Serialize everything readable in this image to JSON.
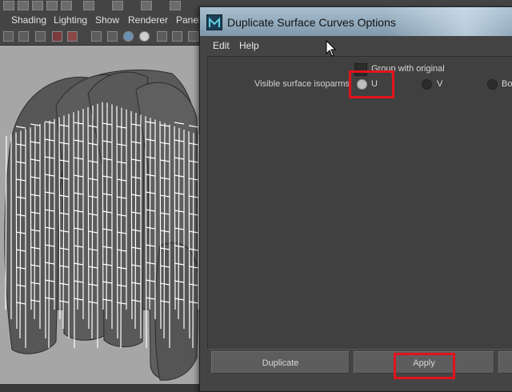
{
  "viewport_menu": {
    "items": [
      "Shading",
      "Lighting",
      "Show",
      "Renderer",
      "Panels"
    ]
  },
  "dialog": {
    "title": "Duplicate Surface Curves Options",
    "menu": [
      "Edit",
      "Help"
    ],
    "group_with_original": {
      "label": "Group with original",
      "checked": false
    },
    "isoparms": {
      "label": "Visible surface isoparms:",
      "options": [
        "U",
        "V",
        "Both"
      ],
      "selected": "U"
    },
    "buttons": {
      "duplicate": "Duplicate",
      "apply": "Apply"
    }
  },
  "annotations": {
    "highlight_color": "#e1131b",
    "highlighted": [
      "isoparm-radio-u",
      "apply-button"
    ]
  },
  "colors": {
    "viewport_bg": "#a6a6a6",
    "dialog_bg": "#444444",
    "hair_fill": "#565656",
    "isoparm_line": "#ffffff"
  }
}
